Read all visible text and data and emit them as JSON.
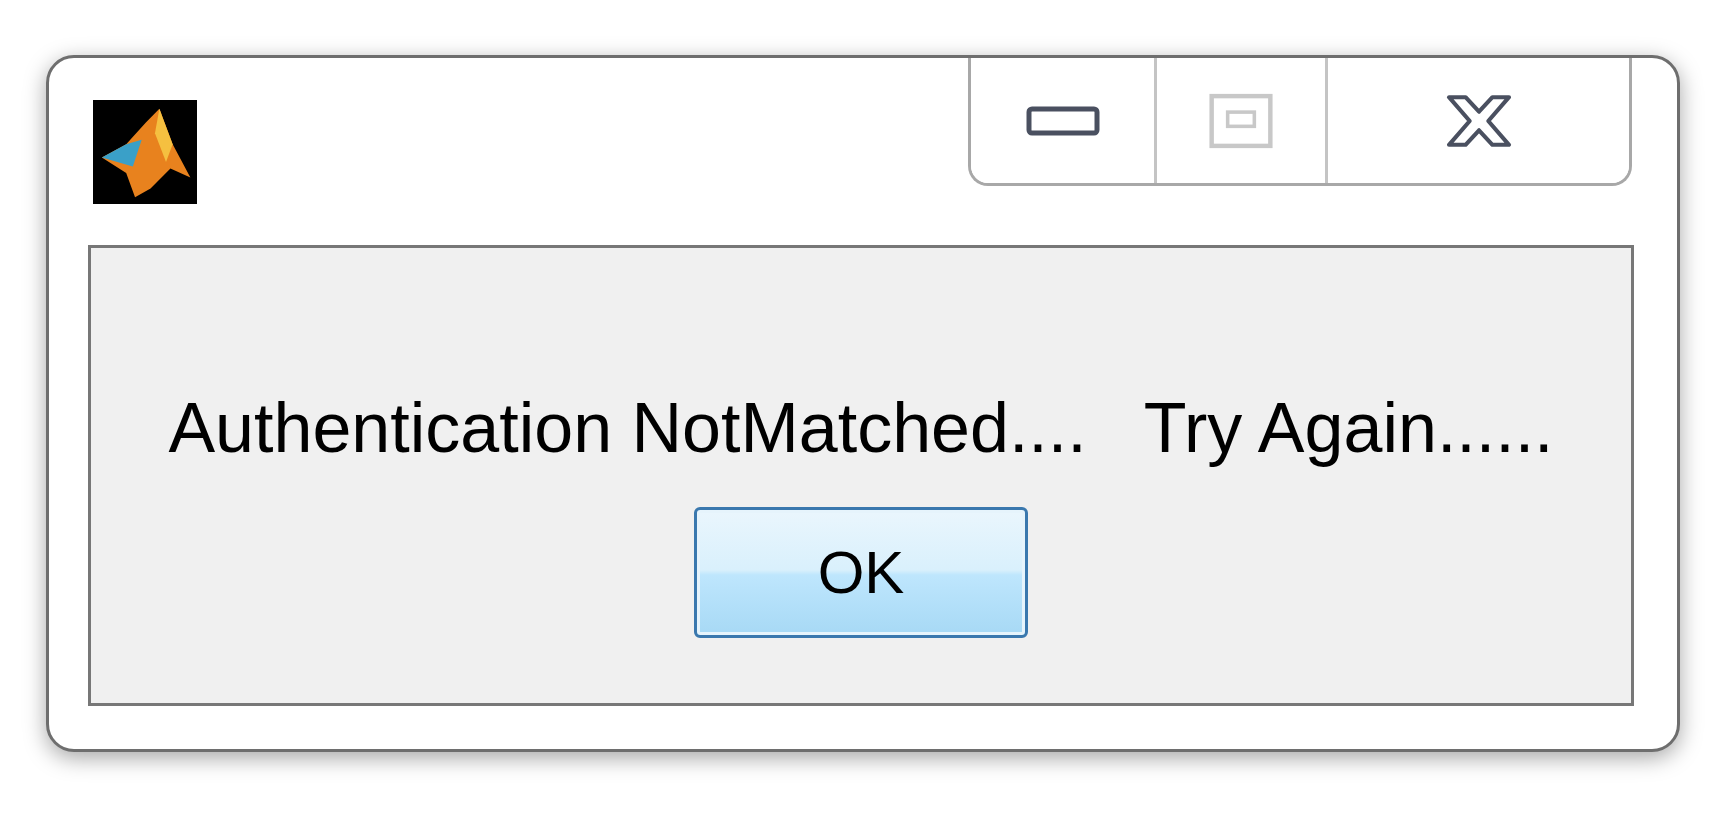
{
  "window_controls": [
    {
      "kind": "minimize",
      "disabled": false
    },
    {
      "kind": "maximize",
      "disabled": true
    },
    {
      "kind": "close",
      "disabled": false
    }
  ],
  "message": "Authentication NotMatched....   Try Again......",
  "buttons": [
    {
      "label": "OK",
      "selected": true
    }
  ]
}
